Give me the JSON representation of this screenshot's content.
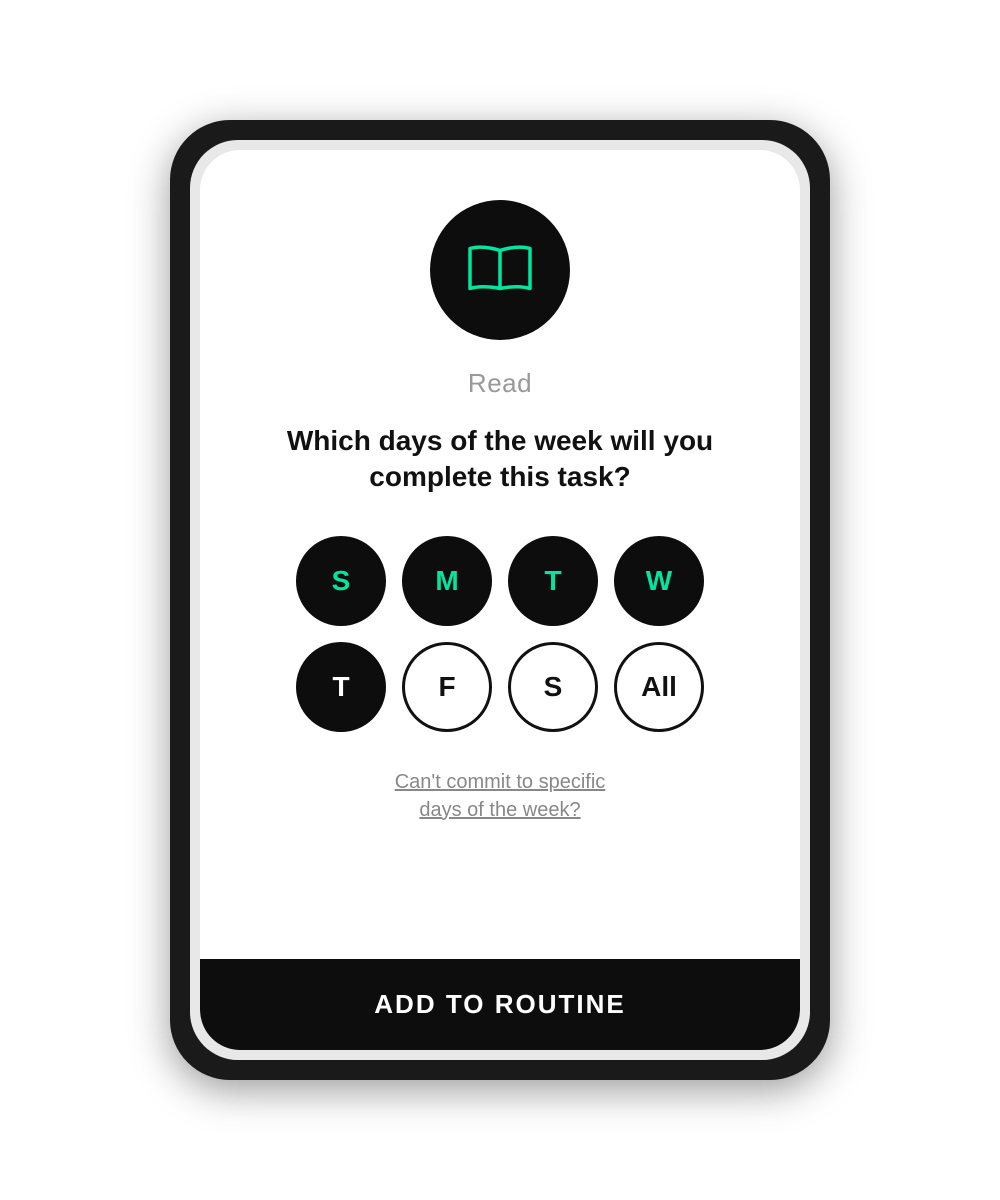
{
  "activity": {
    "label": "Read",
    "icon_name": "book-icon"
  },
  "question": {
    "text": "Which days of the week will you complete this task?"
  },
  "days": {
    "row1": [
      {
        "id": "sunday",
        "label": "S",
        "state": "selected-green"
      },
      {
        "id": "monday",
        "label": "M",
        "state": "selected-green"
      },
      {
        "id": "tuesday",
        "label": "T",
        "state": "selected-green"
      },
      {
        "id": "wednesday",
        "label": "W",
        "state": "selected-green"
      }
    ],
    "row2": [
      {
        "id": "thursday",
        "label": "T",
        "state": "selected-black"
      },
      {
        "id": "friday",
        "label": "F",
        "state": "unselected"
      },
      {
        "id": "saturday",
        "label": "S",
        "state": "unselected"
      },
      {
        "id": "all",
        "label": "All",
        "state": "unselected"
      }
    ]
  },
  "cant_commit": {
    "line1": "Can't commit to specific",
    "line2": "days of the week?"
  },
  "bottom_bar": {
    "button_label": "ADD TO ROUTINE"
  }
}
